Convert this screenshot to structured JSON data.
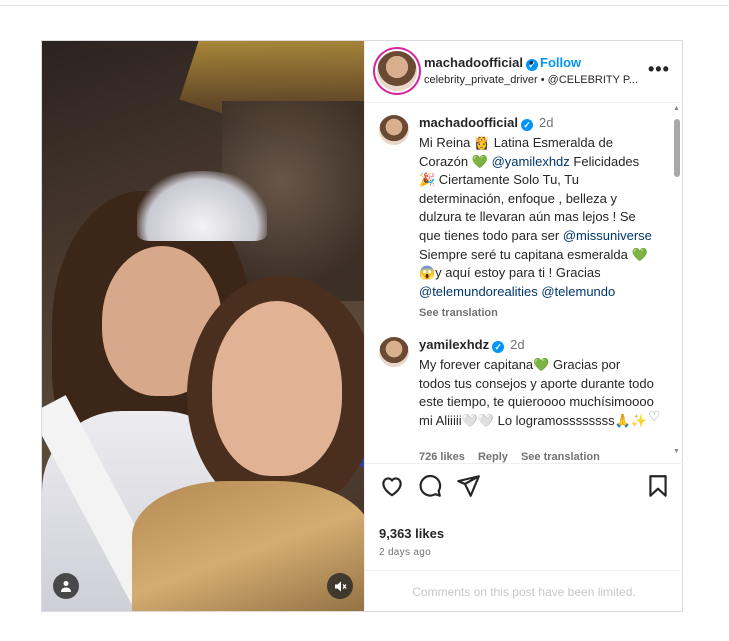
{
  "post": {
    "author": "machadoofficial",
    "verified_badge": "✓",
    "separator": "•",
    "follow_label": "Follow",
    "subtitle": "celebrity_private_driver • @CELEBRITY P...",
    "more_icon": "•••"
  },
  "media": {
    "user_tag_icon": "person-icon",
    "mute_icon": "speaker-muted-icon"
  },
  "comments": [
    {
      "username": "machadoofficial",
      "age": "2d",
      "parts": [
        {
          "t": "Mi Reina 👸 Latina Esmeralda de Corazón "
        },
        {
          "t": "💚",
          "cls": "gheart"
        },
        {
          "t": " "
        },
        {
          "t": "@yamilexhdz",
          "cls": "mention"
        },
        {
          "t": " Felicidades 🎉 Ciertamente Solo Tu, Tu determinación, enfoque , belleza y dulzura te llevaran aún mas lejos ! Se que tienes todo para ser "
        },
        {
          "t": "@missuniverse",
          "cls": "mention"
        },
        {
          "t": " Siempre seré tu capitana esmeralda "
        },
        {
          "t": "💚",
          "cls": "gheart"
        },
        {
          "t": " 😱y aquí estoy para ti ! Gracias "
        },
        {
          "t": "@telemundorealities",
          "cls": "mention"
        },
        {
          "t": " "
        },
        {
          "t": "@telemundo",
          "cls": "mention"
        }
      ],
      "see_translation": "See translation"
    },
    {
      "username": "yamilexhdz",
      "age": "2d",
      "parts": [
        {
          "t": "My forever capitana"
        },
        {
          "t": "💚",
          "cls": "gheart"
        },
        {
          "t": " Gracias por todos tus consejos y aporte durante todo este tiempo, te quieroooo muchísimoooo mi Aliiiii🤍🤍 Lo logramossssssss🙏✨"
        }
      ],
      "likes": "726 likes",
      "reply": "Reply",
      "see_translation": "See translation"
    }
  ],
  "actions": {
    "likes_count": "9,363 likes",
    "date": "2 days ago",
    "comments_limited": "Comments on this post have been limited."
  }
}
